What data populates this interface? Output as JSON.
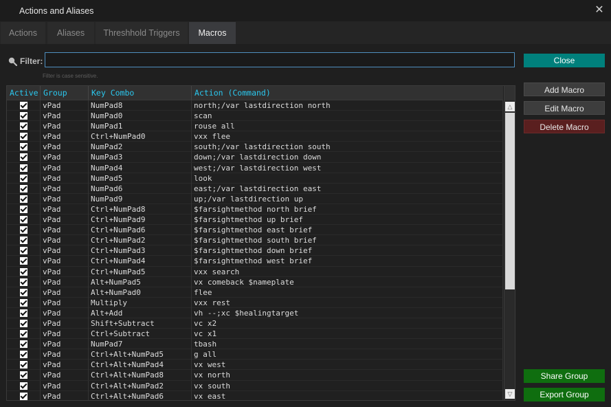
{
  "window": {
    "title": "Actions and Aliases",
    "close_glyph": "✕"
  },
  "tabs": [
    {
      "label": "Actions"
    },
    {
      "label": "Aliases"
    },
    {
      "label": "Threshhold Triggers"
    },
    {
      "label": "Macros"
    }
  ],
  "filter": {
    "label": "Filter:",
    "value": "",
    "hint": "Filter is case sensitive.",
    "icon": "search-icon"
  },
  "buttons": {
    "close": "Close",
    "add": "Add Macro",
    "edit": "Edit Macro",
    "delete": "Delete Macro",
    "share": "Share Group",
    "export": "Export Group"
  },
  "table": {
    "columns": [
      "Active",
      "Group",
      "Key Combo",
      "Action (Command)"
    ],
    "rows": [
      {
        "active": true,
        "group": "vPad",
        "key": "NumPad8",
        "action": "north;/var lastdirection north"
      },
      {
        "active": true,
        "group": "vPad",
        "key": "NumPad0",
        "action": "scan"
      },
      {
        "active": true,
        "group": "vPad",
        "key": "NumPad1",
        "action": "rouse all"
      },
      {
        "active": true,
        "group": "vPad",
        "key": "Ctrl+NumPad0",
        "action": "vxx flee"
      },
      {
        "active": true,
        "group": "vPad",
        "key": "NumPad2",
        "action": "south;/var lastdirection south"
      },
      {
        "active": true,
        "group": "vPad",
        "key": "NumPad3",
        "action": "down;/var lastdirection down"
      },
      {
        "active": true,
        "group": "vPad",
        "key": "NumPad4",
        "action": "west;/var lastdirection west"
      },
      {
        "active": true,
        "group": "vPad",
        "key": "NumPad5",
        "action": "look"
      },
      {
        "active": true,
        "group": "vPad",
        "key": "NumPad6",
        "action": "east;/var lastdirection east"
      },
      {
        "active": true,
        "group": "vPad",
        "key": "NumPad9",
        "action": "up;/var lastdirection up"
      },
      {
        "active": true,
        "group": "vPad",
        "key": "Ctrl+NumPad8",
        "action": "$farsightmethod north brief"
      },
      {
        "active": true,
        "group": "vPad",
        "key": "Ctrl+NumPad9",
        "action": "$farsightmethod up brief"
      },
      {
        "active": true,
        "group": "vPad",
        "key": "Ctrl+NumPad6",
        "action": "$farsightmethod east brief"
      },
      {
        "active": true,
        "group": "vPad",
        "key": "Ctrl+NumPad2",
        "action": "$farsightmethod south brief"
      },
      {
        "active": true,
        "group": "vPad",
        "key": "Ctrl+NumPad3",
        "action": "$farsightmethod down brief"
      },
      {
        "active": true,
        "group": "vPad",
        "key": "Ctrl+NumPad4",
        "action": "$farsightmethod west brief"
      },
      {
        "active": true,
        "group": "vPad",
        "key": "Ctrl+NumPad5",
        "action": "vxx search"
      },
      {
        "active": true,
        "group": "vPad",
        "key": "Alt+NumPad5",
        "action": "vx comeback $nameplate"
      },
      {
        "active": true,
        "group": "vPad",
        "key": "Alt+NumPad0",
        "action": "flee"
      },
      {
        "active": true,
        "group": "vPad",
        "key": "Multiply",
        "action": "vxx rest"
      },
      {
        "active": true,
        "group": "vPad",
        "key": "Alt+Add",
        "action": "vh --;xc $healingtarget"
      },
      {
        "active": true,
        "group": "vPad",
        "key": "Shift+Subtract",
        "action": "vc x2"
      },
      {
        "active": true,
        "group": "vPad",
        "key": "Ctrl+Subtract",
        "action": "vc x1"
      },
      {
        "active": true,
        "group": "vPad",
        "key": "NumPad7",
        "action": "tbash"
      },
      {
        "active": true,
        "group": "vPad",
        "key": "Ctrl+Alt+NumPad5",
        "action": "g all"
      },
      {
        "active": true,
        "group": "vPad",
        "key": "Ctrl+Alt+NumPad4",
        "action": "vx west"
      },
      {
        "active": true,
        "group": "vPad",
        "key": "Ctrl+Alt+NumPad8",
        "action": "vx north"
      },
      {
        "active": true,
        "group": "vPad",
        "key": "Ctrl+Alt+NumPad2",
        "action": "vx south"
      },
      {
        "active": true,
        "group": "vPad",
        "key": "Ctrl+Alt+NumPad6",
        "action": "vx east"
      }
    ]
  },
  "colors": {
    "accent_close": "#00807c",
    "share_export": "#0f6e0f",
    "delete": "#5a1f1f",
    "header_text": "#2bc8ef"
  }
}
